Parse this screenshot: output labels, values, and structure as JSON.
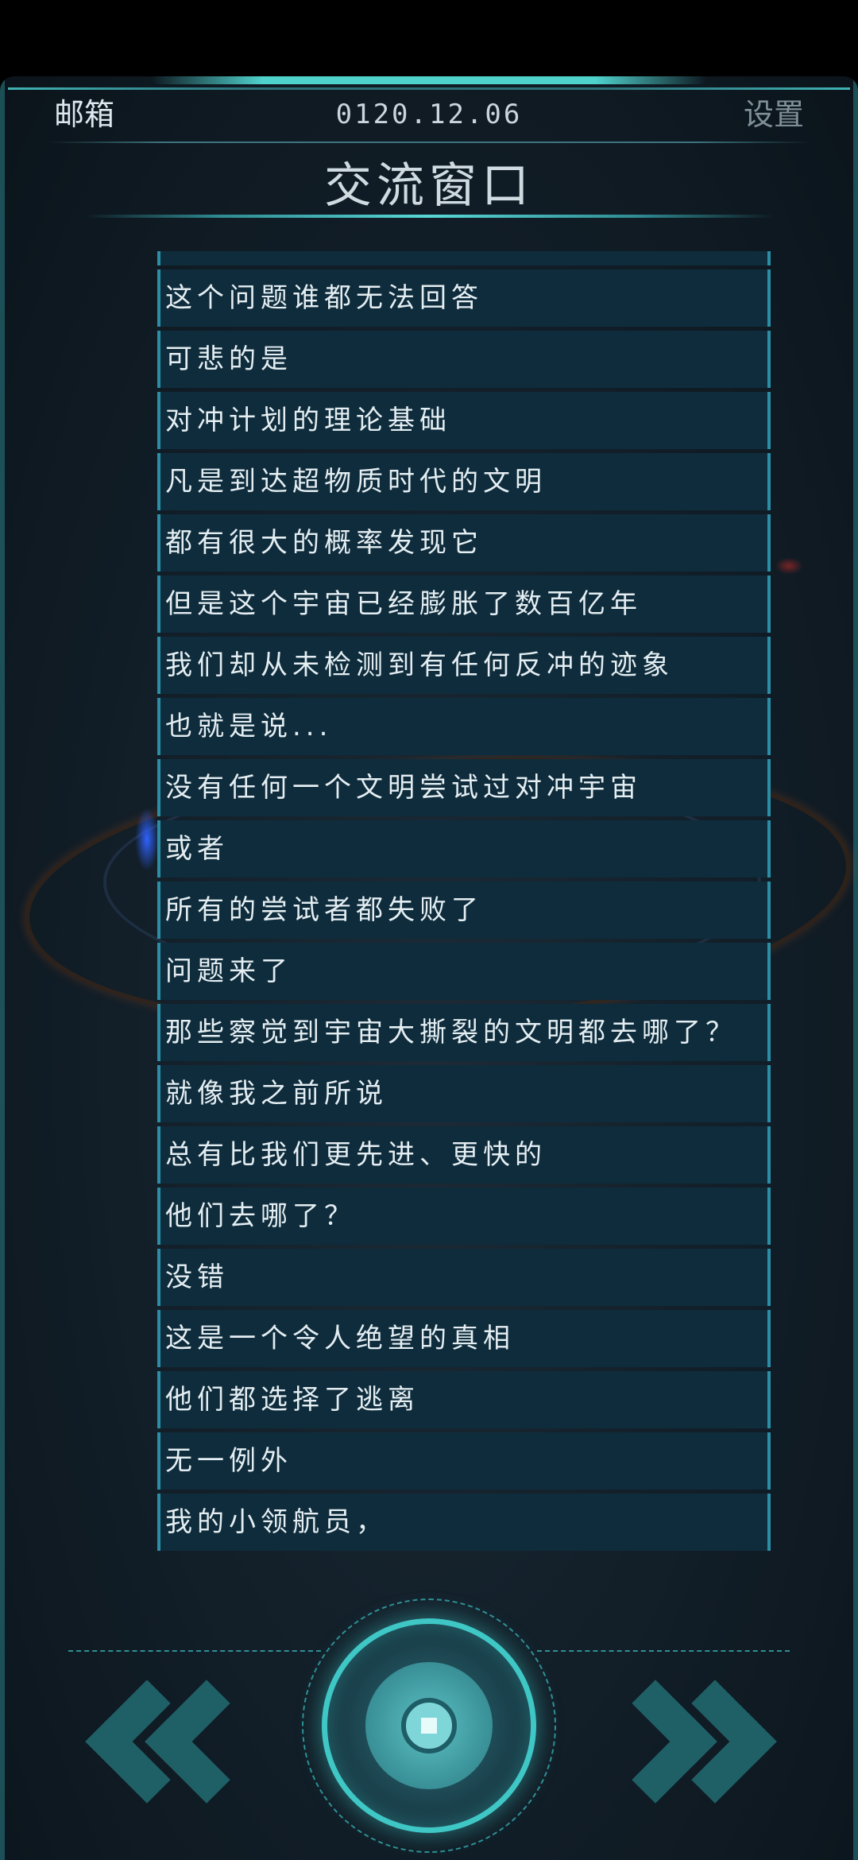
{
  "header": {
    "left_label": "邮箱",
    "date": "0120.12.06",
    "right_label": "设置"
  },
  "title": "交流窗口",
  "messages": [
    "这个问题谁都无法回答",
    "可悲的是",
    "对冲计划的理论基础",
    "凡是到达超物质时代的文明",
    "都有很大的概率发现它",
    "但是这个宇宙已经膨胀了数百亿年",
    "我们却从未检测到有任何反冲的迹象",
    "也就是说...",
    "没有任何一个文明尝试过对冲宇宙",
    "或者",
    "所有的尝试者都失败了",
    "问题来了",
    "那些察觉到宇宙大撕裂的文明都去哪了？",
    "就像我之前所说",
    "总有比我们更先进、更快的",
    "他们去哪了？",
    "没错",
    "这是一个令人绝望的真相",
    "他们都选择了逃离",
    "无一例外",
    "我的小领航员，"
  ],
  "controls": {
    "prev_icon": "double-chevron-left-icon",
    "next_icon": "double-chevron-right-icon",
    "center_icon": "circle-button-icon"
  },
  "colors": {
    "accent": "#3fc7c6",
    "message_bg": "#0f2c3c",
    "message_border": "#2c8ea6"
  }
}
